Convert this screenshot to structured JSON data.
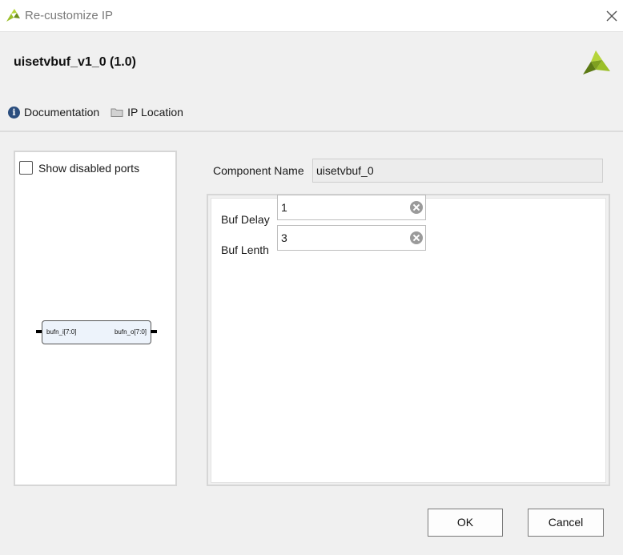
{
  "window": {
    "title": "Re-customize IP"
  },
  "header": {
    "ip_name": "uisetvbuf_v1_0 (1.0)",
    "links": [
      {
        "label": "Documentation",
        "icon": "info-icon"
      },
      {
        "label": "IP Location",
        "icon": "folder-icon"
      }
    ]
  },
  "symbol_panel": {
    "show_disabled_ports_label": "Show disabled ports",
    "show_disabled_ports_checked": false,
    "block": {
      "input_port": "bufn_i[7:0]",
      "output_port": "bufn_o[7:0]"
    }
  },
  "component": {
    "label": "Component Name",
    "value": "uisetvbuf_0"
  },
  "parameters": [
    {
      "label": "Buf Delay",
      "value": "1"
    },
    {
      "label": "Buf Lenth",
      "value": "3"
    }
  ],
  "buttons": {
    "ok": "OK",
    "cancel": "Cancel"
  },
  "colors": {
    "brand_green": "#9bbf29",
    "brand_dark": "#5c7a14",
    "info_blue": "#2b4e7e"
  }
}
